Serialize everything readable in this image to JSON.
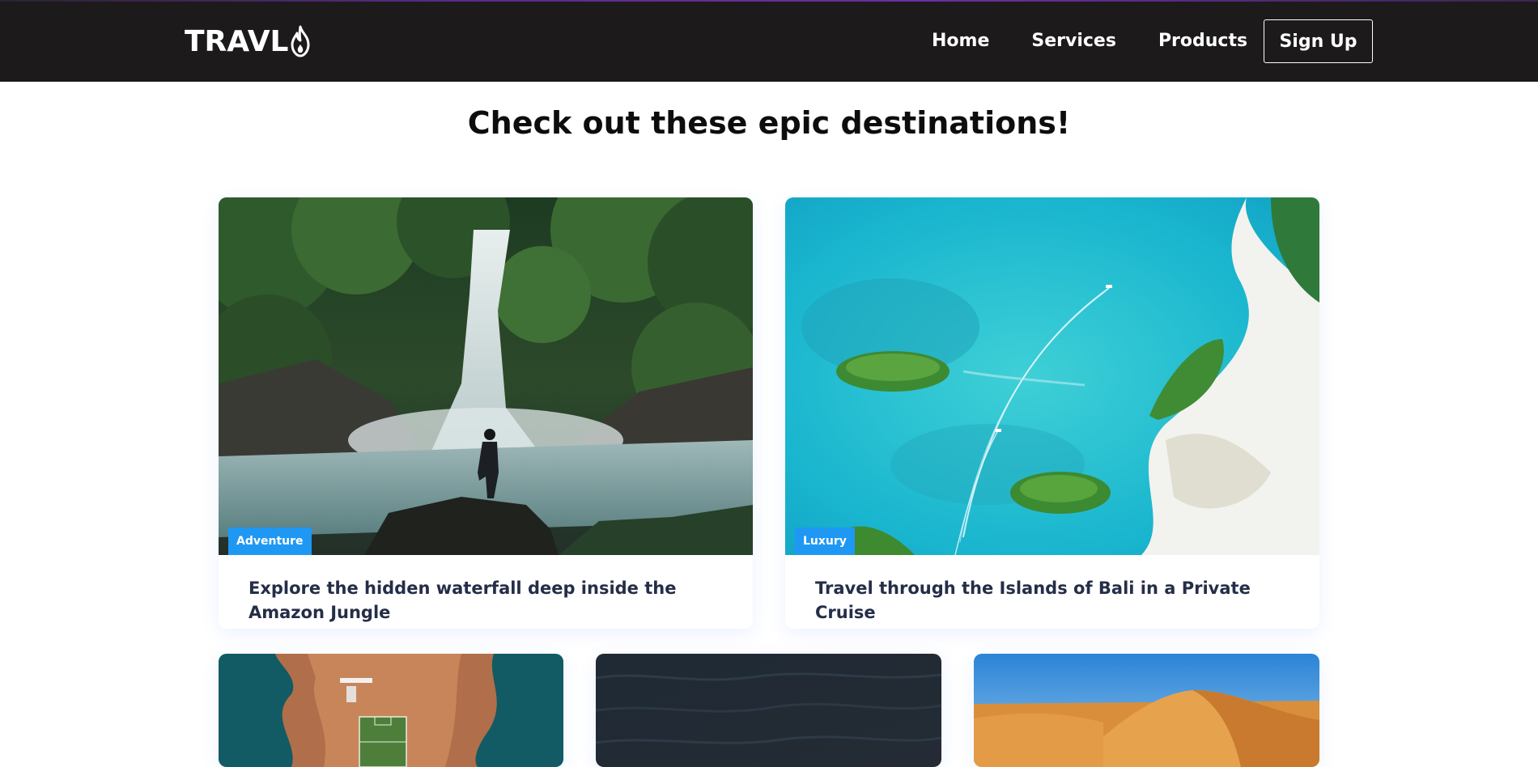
{
  "navbar": {
    "logo_text": "TRAVL",
    "logo_icon": "flame-icon",
    "links": [
      {
        "label": "Home"
      },
      {
        "label": "Services"
      },
      {
        "label": "Products"
      }
    ],
    "signup_label": "Sign Up",
    "background": "#1c1a1b"
  },
  "main": {
    "title": "Check out these epic destinations!"
  },
  "cards": [
    {
      "tag": "Adventure",
      "text": "Explore the hidden waterfall deep inside the Amazon Jungle",
      "image": "waterfall-image"
    },
    {
      "tag": "Luxury",
      "text": "Travel through the Islands of Bali in a Private Cruise",
      "image": "islands-aerial-image"
    },
    {
      "image": "coastal-football-pitch-image"
    },
    {
      "image": "dark-ocean-image"
    },
    {
      "image": "desert-dunes-image"
    }
  ],
  "colors": {
    "tag_background": "#1f98f4",
    "card_text": "#252e48",
    "heading": "#0d0d0d"
  }
}
